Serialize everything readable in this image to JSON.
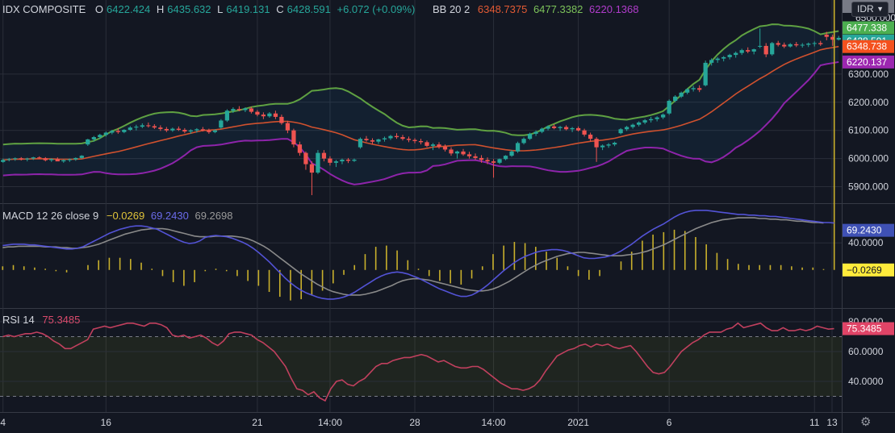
{
  "header": {
    "symbol": "IDX COMPOSITE",
    "open_label": "O",
    "open": "6422.424",
    "high_label": "H",
    "high": "6435.632",
    "low_label": "L",
    "low": "6419.131",
    "close_label": "C",
    "close": "6428.591",
    "change": "+6.072 (+0.09%)",
    "bb_label": "BB 20 2",
    "bb_mid": "6348.7375",
    "bb_upper": "6477.3382",
    "bb_lower": "6220.1368"
  },
  "macd_legend": {
    "label": "MACD 12 26 close 9",
    "hist": "−0.0269",
    "macd": "69.2430",
    "signal": "69.2698"
  },
  "rsi_legend": {
    "label": "RSI 14",
    "value": "75.3485"
  },
  "currency": {
    "label": "IDR",
    "icon": "chevron-down-icon"
  },
  "settings": {
    "icon": "gear-icon"
  },
  "colors": {
    "up": "#26a69a",
    "down": "#ef5350",
    "upper_band": "#5fa142",
    "basis": "#d0512e",
    "lower_band": "#8e24aa",
    "macd": "#5353d6",
    "signal": "#8a8a8a",
    "histogram": "#c9b02c",
    "rsi": "#c1405e"
  },
  "chart_data": [
    {
      "type": "candlestick",
      "name": "IDX COMPOSITE",
      "price_axis_ticks": [
        "6300.000",
        "6200.000",
        "6100.000",
        "6000.000",
        "5900.000"
      ],
      "price_axis_partial_top": "6500.000",
      "time_axis_labels": [
        "4",
        "16",
        "21",
        "14:00",
        "28",
        "14:00",
        "2021",
        "6",
        "11",
        "13"
      ],
      "ylim": [
        5850,
        6500
      ],
      "last_values": {
        "upper": "6477.338",
        "close": "6428.591",
        "basis": "6348.738",
        "lower": "6220.137"
      },
      "candles": [
        [
          5988,
          6000,
          5985,
          5995
        ],
        [
          5995,
          6002,
          5990,
          5998
        ],
        [
          5998,
          6004,
          5992,
          6001
        ],
        [
          6001,
          6005,
          5993,
          5997
        ],
        [
          5997,
          6003,
          5990,
          6000
        ],
        [
          6000,
          6006,
          5995,
          6004
        ],
        [
          6004,
          6008,
          5999,
          6001
        ],
        [
          6001,
          6005,
          5990,
          5994
        ],
        [
          5994,
          6001,
          5988,
          5998
        ],
        [
          5998,
          6004,
          5992,
          5990
        ],
        [
          5990,
          5997,
          5985,
          5994
        ],
        [
          5994,
          6000,
          5988,
          5997
        ],
        [
          5997,
          6004,
          5992,
          6002
        ],
        [
          6002,
          6012,
          5999,
          6010
        ],
        [
          6050,
          6070,
          6045,
          6068
        ],
        [
          6068,
          6080,
          6060,
          6076
        ],
        [
          6076,
          6088,
          6070,
          6084
        ],
        [
          6084,
          6096,
          6078,
          6092
        ],
        [
          6092,
          6102,
          6086,
          6098
        ],
        [
          6098,
          6108,
          6088,
          6094
        ],
        [
          6094,
          6104,
          6090,
          6102
        ],
        [
          6102,
          6115,
          6098,
          6110
        ],
        [
          6110,
          6120,
          6100,
          6113
        ],
        [
          6113,
          6125,
          6108,
          6118
        ],
        [
          6118,
          6128,
          6110,
          6115
        ],
        [
          6115,
          6122,
          6105,
          6110
        ],
        [
          6110,
          6118,
          6098,
          6105
        ],
        [
          6105,
          6112,
          6094,
          6100
        ],
        [
          6100,
          6110,
          6095,
          6106
        ],
        [
          6106,
          6114,
          6098,
          6102
        ],
        [
          6102,
          6108,
          6090,
          6096
        ],
        [
          6096,
          6104,
          6088,
          6100
        ],
        [
          6100,
          6108,
          6092,
          6104
        ],
        [
          6104,
          6112,
          6096,
          6100
        ],
        [
          6100,
          6106,
          6088,
          6094
        ],
        [
          6094,
          6104,
          6090,
          6100
        ],
        [
          6110,
          6140,
          6105,
          6135
        ],
        [
          6135,
          6175,
          6130,
          6170
        ],
        [
          6170,
          6182,
          6162,
          6176
        ],
        [
          6176,
          6186,
          6168,
          6172
        ],
        [
          6172,
          6182,
          6165,
          6178
        ],
        [
          6178,
          6184,
          6160,
          6166
        ],
        [
          6166,
          6172,
          6150,
          6156
        ],
        [
          6156,
          6164,
          6140,
          6150
        ],
        [
          6150,
          6165,
          6145,
          6160
        ],
        [
          6160,
          6170,
          6140,
          6148
        ],
        [
          6148,
          6156,
          6120,
          6126
        ],
        [
          6126,
          6134,
          6090,
          6100
        ],
        [
          6100,
          6106,
          6040,
          6050
        ],
        [
          6050,
          6060,
          6010,
          6020
        ],
        [
          6020,
          6025,
          5960,
          5980
        ],
        [
          5980,
          5990,
          5870,
          5950
        ],
        [
          5950,
          6030,
          5945,
          6020
        ],
        [
          6020,
          6030,
          5990,
          6000
        ],
        [
          6000,
          6008,
          5975,
          5985
        ],
        [
          5985,
          5995,
          5970,
          5990
        ],
        [
          5990,
          6000,
          5980,
          5996
        ],
        [
          5996,
          6002,
          5984,
          5992
        ],
        [
          5992,
          6000,
          5988,
          5996
        ],
        [
          6040,
          6075,
          6035,
          6070
        ],
        [
          6070,
          6080,
          6060,
          6065
        ],
        [
          6065,
          6072,
          6050,
          6060
        ],
        [
          6060,
          6070,
          6052,
          6068
        ],
        [
          6068,
          6078,
          6060,
          6072
        ],
        [
          6072,
          6084,
          6066,
          6080
        ],
        [
          6080,
          6090,
          6070,
          6076
        ],
        [
          6076,
          6084,
          6064,
          6070
        ],
        [
          6070,
          6078,
          6058,
          6066
        ],
        [
          6066,
          6072,
          6054,
          6062
        ],
        [
          6062,
          6070,
          6050,
          6058
        ],
        [
          6058,
          6064,
          6040,
          6045
        ],
        [
          6045,
          6055,
          6030,
          6050
        ],
        [
          6050,
          6058,
          6035,
          6042
        ],
        [
          6042,
          6050,
          6025,
          6032
        ],
        [
          6032,
          6040,
          6010,
          6018
        ],
        [
          6018,
          6028,
          6000,
          6025
        ],
        [
          6025,
          6034,
          6010,
          6015
        ],
        [
          6015,
          6024,
          6000,
          6008
        ],
        [
          6008,
          6018,
          5995,
          6002
        ],
        [
          6002,
          6012,
          5985,
          5995
        ],
        [
          5995,
          6004,
          5980,
          5990
        ],
        [
          5990,
          5998,
          5932,
          5985
        ],
        [
          5985,
          6000,
          5980,
          5998
        ],
        [
          5998,
          6012,
          5994,
          6010
        ],
        [
          6010,
          6030,
          6006,
          6025
        ],
        [
          6025,
          6060,
          6020,
          6055
        ],
        [
          6055,
          6075,
          6050,
          6070
        ],
        [
          6070,
          6092,
          6066,
          6088
        ],
        [
          6088,
          6100,
          6080,
          6095
        ],
        [
          6095,
          6110,
          6090,
          6106
        ],
        [
          6106,
          6118,
          6100,
          6114
        ],
        [
          6114,
          6122,
          6104,
          6108
        ],
        [
          6108,
          6116,
          6098,
          6112
        ],
        [
          6112,
          6118,
          6100,
          6104
        ],
        [
          6104,
          6112,
          6094,
          6108
        ],
        [
          6108,
          6114,
          6096,
          6100
        ],
        [
          6100,
          6106,
          6078,
          6085
        ],
        [
          6085,
          6092,
          6060,
          6070
        ],
        [
          6070,
          6076,
          5988,
          6040
        ],
        [
          6040,
          6050,
          6030,
          6046
        ],
        [
          6046,
          6055,
          6038,
          6050
        ],
        [
          6050,
          6060,
          6044,
          6056
        ],
        [
          6090,
          6108,
          6086,
          6104
        ],
        [
          6104,
          6116,
          6098,
          6112
        ],
        [
          6112,
          6124,
          6106,
          6120
        ],
        [
          6120,
          6132,
          6114,
          6128
        ],
        [
          6128,
          6140,
          6122,
          6136
        ],
        [
          6136,
          6148,
          6128,
          6140
        ],
        [
          6140,
          6150,
          6132,
          6146
        ],
        [
          6146,
          6160,
          6140,
          6156
        ],
        [
          6160,
          6210,
          6155,
          6205
        ],
        [
          6205,
          6225,
          6200,
          6220
        ],
        [
          6220,
          6238,
          6215,
          6234
        ],
        [
          6234,
          6250,
          6228,
          6246
        ],
        [
          6246,
          6258,
          6238,
          6250
        ],
        [
          6250,
          6260,
          6236,
          6244
        ],
        [
          6260,
          6348,
          6256,
          6340
        ],
        [
          6340,
          6356,
          6330,
          6350
        ],
        [
          6350,
          6360,
          6340,
          6355
        ],
        [
          6355,
          6364,
          6345,
          6360
        ],
        [
          6360,
          6372,
          6352,
          6368
        ],
        [
          6368,
          6380,
          6358,
          6375
        ],
        [
          6375,
          6390,
          6368,
          6385
        ],
        [
          6385,
          6395,
          6374,
          6380
        ],
        [
          6380,
          6390,
          6370,
          6388
        ],
        [
          6400,
          6462,
          6392,
          6400
        ],
        [
          6400,
          6410,
          6360,
          6370
        ],
        [
          6370,
          6414,
          6365,
          6410
        ],
        [
          6410,
          6418,
          6398,
          6404
        ],
        [
          6404,
          6412,
          6392,
          6398
        ],
        [
          6398,
          6410,
          6394,
          6406
        ],
        [
          6406,
          6414,
          6396,
          6402
        ],
        [
          6402,
          6410,
          6394,
          6404
        ],
        [
          6404,
          6412,
          6396,
          6408
        ],
        [
          6408,
          6416,
          6398,
          6410
        ],
        [
          6410,
          6418,
          6400,
          6406
        ],
        [
          6440,
          6450,
          6420,
          6432
        ],
        [
          6432,
          6440,
          6400,
          6422
        ],
        [
          6422,
          6435.632,
          6419.131,
          6428.591
        ]
      ]
    },
    {
      "type": "line",
      "name": "MACD 12 26 close 9",
      "y_axis_ticks": [
        "40.0000"
      ],
      "last_values": {
        "signal": "69.2698",
        "macd": "69.2430",
        "histogram": "−0.0269"
      },
      "ylim": [
        -55,
        95
      ],
      "macd": [
        36,
        37,
        38,
        38,
        38,
        37,
        37,
        36,
        35,
        34,
        33,
        32,
        31,
        31,
        32,
        34,
        38,
        42,
        46,
        50,
        54,
        57,
        60,
        62,
        64,
        65,
        65,
        64,
        62,
        60,
        56,
        52,
        48,
        44,
        41,
        39,
        40,
        43,
        48,
        50,
        51,
        50,
        49,
        47,
        44,
        41,
        37,
        32,
        26,
        19,
        12,
        4,
        -4,
        -12,
        -19,
        -25,
        -30,
        -34,
        -37,
        -40,
        -42,
        -43,
        -43,
        -42,
        -40,
        -37,
        -33,
        -28,
        -23,
        -18,
        -13,
        -9,
        -6,
        -4,
        -3,
        -4,
        -6,
        -9,
        -12,
        -16,
        -20,
        -24,
        -28,
        -31,
        -34,
        -37,
        -39,
        -39,
        -37,
        -33,
        -28,
        -22,
        -15,
        -8,
        -1,
        5,
        11,
        16,
        20,
        23,
        26,
        28,
        29,
        30,
        30,
        29,
        27,
        24,
        21,
        18,
        17,
        17,
        18,
        19,
        21,
        24,
        28,
        33,
        38,
        44,
        50,
        55,
        60,
        64,
        68,
        73,
        78,
        82,
        85,
        87,
        88,
        88,
        88,
        87,
        86,
        85,
        84,
        83,
        82,
        82,
        81,
        81,
        80,
        80,
        79,
        79,
        78,
        77,
        76,
        75,
        74,
        73,
        72,
        71,
        70,
        70,
        69.243
      ],
      "signal": [
        33,
        34,
        34,
        35,
        35,
        35,
        35,
        35,
        34,
        34,
        34,
        33,
        33,
        32,
        32,
        33,
        34,
        36,
        38,
        41,
        44,
        47,
        50,
        53,
        55,
        57,
        59,
        60,
        61,
        61,
        61,
        60,
        58,
        56,
        54,
        52,
        50,
        49,
        49,
        49,
        50,
        50,
        50,
        50,
        49,
        48,
        46,
        43,
        39,
        35,
        30,
        24,
        18,
        12,
        6,
        0,
        -6,
        -11,
        -16,
        -21,
        -25,
        -29,
        -32,
        -34,
        -36,
        -37,
        -37,
        -37,
        -36,
        -34,
        -32,
        -29,
        -26,
        -23,
        -19,
        -16,
        -14,
        -13,
        -13,
        -14,
        -15,
        -17,
        -19,
        -21,
        -23,
        -25,
        -27,
        -29,
        -30,
        -31,
        -31,
        -30,
        -28,
        -25,
        -21,
        -17,
        -12,
        -7,
        -2,
        3,
        7,
        11,
        14,
        17,
        20,
        22,
        24,
        25,
        26,
        26,
        25,
        24,
        23,
        22,
        21,
        21,
        21,
        22,
        23,
        24,
        26,
        28,
        31,
        34,
        37,
        41,
        45,
        49,
        53,
        57,
        61,
        64,
        67,
        70,
        72,
        74,
        75,
        76,
        77,
        77,
        77,
        77,
        76,
        76,
        75,
        75,
        74,
        74,
        73,
        72,
        72,
        71,
        70,
        70,
        69.2698
      ]
    },
    {
      "type": "line",
      "name": "RSI 14",
      "y_axis_ticks": [
        "80.0000",
        "60.0000",
        "40.0000"
      ],
      "upper_band": 70,
      "lower_band": 30,
      "ylim": [
        20,
        87
      ],
      "last_value": "75.3485",
      "values": [
        70,
        71,
        70,
        71,
        72,
        72,
        73,
        72,
        70,
        67,
        65,
        62,
        62,
        64,
        66,
        68,
        75,
        76,
        77,
        76,
        77,
        78,
        79,
        79,
        78,
        77,
        79,
        79,
        78,
        76,
        71,
        70,
        71,
        69,
        70,
        71,
        69,
        66,
        64,
        67,
        72,
        73,
        73,
        72,
        71,
        68,
        66,
        63,
        60,
        55,
        50,
        42,
        35,
        34,
        31,
        33,
        29,
        27,
        35,
        40,
        41,
        38,
        37,
        40,
        42,
        46,
        50,
        52,
        52,
        54,
        55,
        56,
        56,
        57,
        58,
        57,
        55,
        53,
        54,
        52,
        50,
        49,
        49,
        50,
        50,
        48,
        45,
        42,
        39,
        37,
        35,
        35,
        34,
        35,
        37,
        41,
        47,
        52,
        57,
        59,
        61,
        62,
        64,
        65,
        63,
        65,
        64,
        65,
        63,
        62,
        63,
        64,
        60,
        55,
        50,
        46,
        45,
        46,
        50,
        55,
        60,
        63,
        66,
        68,
        71,
        73,
        73,
        73,
        75,
        76,
        79,
        76,
        77,
        78,
        79,
        76,
        74,
        74,
        76,
        74,
        74,
        75,
        74,
        75,
        77,
        76,
        75,
        75.3485
      ]
    }
  ]
}
